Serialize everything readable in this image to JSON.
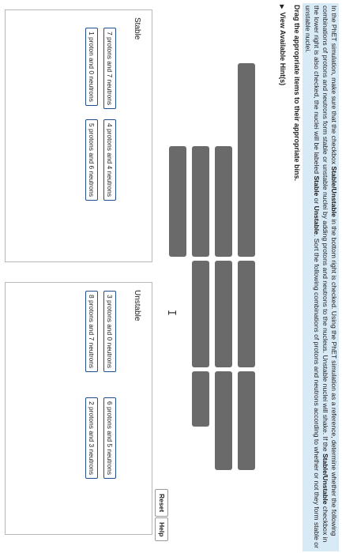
{
  "instructions": {
    "part1": "In the PhET simulation, make sure that the checkbox ",
    "bold1": "Stable/Unstable",
    "part2": " in the bottom right is checked. Using the PhET simulation as a reference, determine whether the following combinations of protons and neutrons form stable or unstable nuclei by adding protons and neutrons to the nucleus. Unstable nuclei will shake. If the ",
    "bold2": "Stable/Unstable",
    "part3": " checkbox in the lower right is also checked, the nuclei will be labeled ",
    "bold3": "Stable",
    "part4": " or ",
    "bold4": "Unstable",
    "part5": ". Sort the following combinations of protons and neutrons according to whether or not they form stable or unstable nuclei."
  },
  "drag_prompt": "Drag the appropriate items to their appropriate bins.",
  "hints_label": "View Available Hint(s)",
  "cursor_glyph": "I",
  "buttons": {
    "reset": "Reset",
    "help": "Help"
  },
  "bins": {
    "stable": {
      "title": "Stable",
      "items": [
        "7 protons and 7 neutrons",
        "4 protons and 4 neutrons",
        "1 proton and 0 neutrons",
        "5 protons and 6 neutrons"
      ]
    },
    "unstable": {
      "title": "Unstable",
      "items": [
        "3 protons and 0 neutrons",
        "6 protons and 5 neutrons",
        "8 protons and 7 neutrons",
        "2 protons and 3 neutrons"
      ]
    }
  },
  "colors": {
    "placeholder": "#6a6a6a",
    "instruction_bg": "#d9eaf7",
    "card_border": "#1f4e8c"
  },
  "icons": {
    "hint_toggle": "triangle-right-icon",
    "cursor": "text-cursor-icon"
  }
}
